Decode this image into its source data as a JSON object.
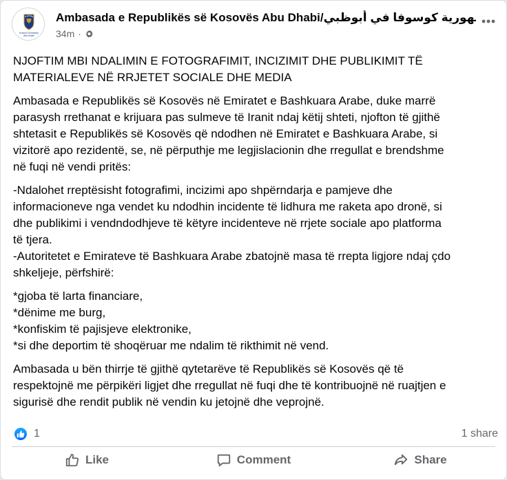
{
  "post": {
    "author": "Ambasada e Republikës së Kosovës Abu Dhabi/سفارة جمهورية كوسوفا في أبوظبي",
    "timestamp": "34m",
    "separator": "·",
    "avatar_text_1": "Kosovo Embassy",
    "avatar_text_2": "Abu Dhabi",
    "title_lines": [
      "NJOFTIM MBI NDALIMIN E FOTOGRAFIMIT, INCIZIMIT DHE PUBLIKIMIT TË",
      "MATERIALEVE NË RRJETET SOCIALE DHE MEDIA"
    ],
    "para1_lines": [
      "Ambasada e Republikës së Kosovës në Emiratet e Bashkuara Arabe, duke marrë",
      "parasysh rrethanat e krijuara pas sulmeve të Iranit ndaj këtij shteti, njofton të gjithë",
      "shtetasit e Republikës së Kosovës që ndodhen në Emiratet e Bashkuara Arabe, si",
      "vizitorë apo rezidentë, se, në përputhje me legjislacionin dhe rregullat e brendshme",
      "në fuqi në vendi pritës:"
    ],
    "para2_lines": [
      "-Ndalohet rreptësisht fotografimi, incizimi apo shpërndarja e pamjeve dhe",
      "informacioneve nga vendet ku ndodhin incidente të lidhura me raketa apo dronë, si",
      "dhe publikimi i vendndodhjeve të këtyre incidenteve në rrjete sociale apo platforma",
      "të tjera.",
      "-Autoritetet e Emirateve të Bashkuara Arabe zbatojnë masa të rrepta ligjore ndaj çdo",
      "shkeljeje, përfshirë:"
    ],
    "penalties": [
      "*gjoba të larta financiare,",
      "*dënime me burg,",
      "*konfiskim të pajisjeve elektronike,",
      "*si dhe deportim të shoqëruar me ndalim të rikthimit në vend."
    ],
    "para3_lines": [
      "Ambasada u bën thirrje të gjithë qytetarëve të Republikës së Kosovës që të",
      "respektojnë me përpikëri ligjet dhe rregullat në fuqi dhe të kontribuojnë në ruajtjen e",
      "sigurisë dhe rendit publik në vendin ku jetojnë dhe veprojnë."
    ]
  },
  "stats": {
    "reaction_count": "1",
    "shares": "1 share"
  },
  "actions": {
    "like": "Like",
    "comment": "Comment",
    "share": "Share"
  },
  "colors": {
    "brand_blue": "#0866ff",
    "secondary_text": "#65676b",
    "emblem_blue": "#1b3a8c",
    "emblem_gold": "#d4a017"
  }
}
